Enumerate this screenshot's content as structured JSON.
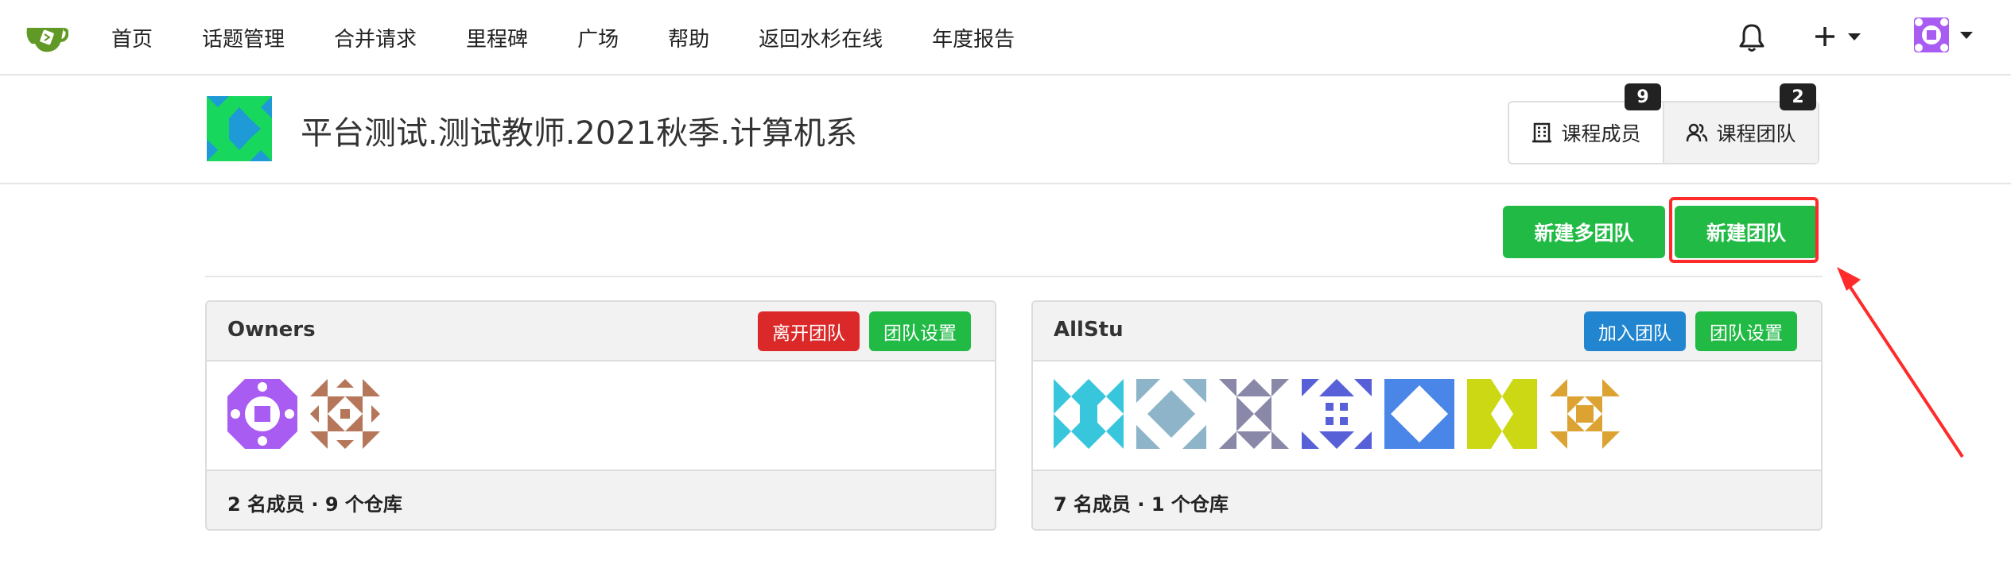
{
  "nav": {
    "items": [
      "首页",
      "话题管理",
      "合并请求",
      "里程碑",
      "广场",
      "帮助",
      "返回水杉在线",
      "年度报告"
    ],
    "logo_icon": "gitea-teapot-icon",
    "notification_icon": "bell-icon",
    "create_icon": "plus-icon",
    "user_icon": "user-avatar"
  },
  "org": {
    "title": "平台测试.测试教师.2021秋季.计算机系",
    "tabs": [
      {
        "label": "课程成员",
        "count": "9",
        "icon": "building-icon"
      },
      {
        "label": "课程团队",
        "count": "2",
        "icon": "people-icon"
      }
    ]
  },
  "actions": {
    "new_multi_team": "新建多团队",
    "new_team": "新建团队"
  },
  "teams": [
    {
      "name": "Owners",
      "buttons": [
        "离开团队",
        "团队设置"
      ],
      "member_colors": [
        "#a95cf2",
        "#b5765a"
      ],
      "footer": "2 名成员 · 9 个仓库"
    },
    {
      "name": "AllStu",
      "buttons": [
        "加入团队",
        "团队设置"
      ],
      "member_colors": [
        "#38c6dc",
        "#8db4c8",
        "#8a88a8",
        "#5860d8",
        "#4a86e8",
        "#cdd814",
        "#dca332"
      ],
      "footer": "7 名成员 · 1 个仓库"
    }
  ],
  "colors": {
    "green": "#21ba45",
    "red": "#db2828",
    "blue": "#2185d0",
    "highlight": "#ff2a2a"
  }
}
